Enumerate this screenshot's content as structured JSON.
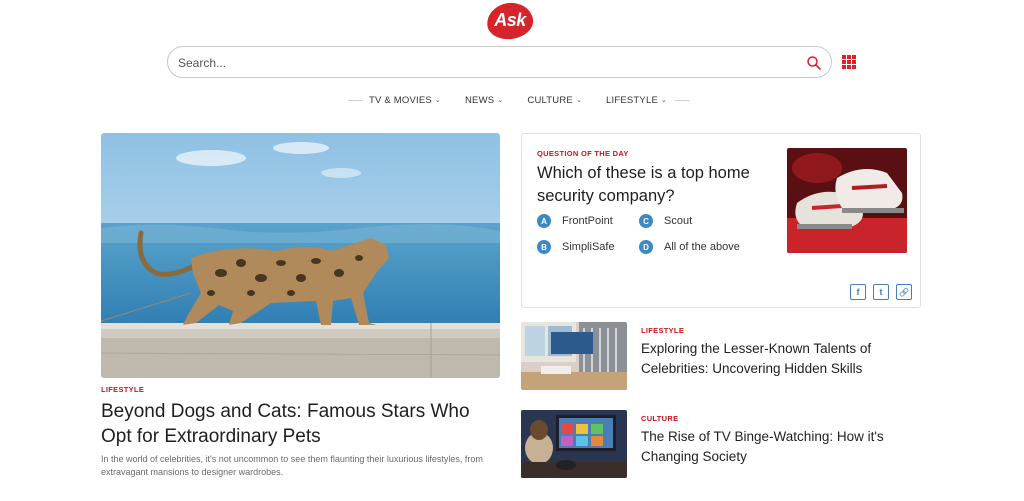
{
  "brand": {
    "logo_text": "Ask",
    "accent": "#d6242a"
  },
  "search": {
    "placeholder": "Search...",
    "icon": "search-icon"
  },
  "apps_icon": "grid-icon",
  "nav": {
    "items": [
      {
        "label": "TV & MOVIES"
      },
      {
        "label": "NEWS"
      },
      {
        "label": "CULTURE"
      },
      {
        "label": "LIFESTYLE"
      }
    ]
  },
  "hero": {
    "category": "LIFESTYLE",
    "title": "Beyond Dogs and Cats: Famous Stars Who Opt for Extraordinary Pets",
    "description": "In the world of celebrities, it's not uncommon to see them flaunting their luxurious lifestyles, from extravagant mansions to designer wardrobes."
  },
  "question": {
    "label": "QUESTION OF THE DAY",
    "text": "Which of these is a top home security company?",
    "options": [
      {
        "letter": "A",
        "label": "FrontPoint"
      },
      {
        "letter": "B",
        "label": "SimpliSafe"
      },
      {
        "letter": "C",
        "label": "Scout"
      },
      {
        "letter": "D",
        "label": "All of the above"
      }
    ],
    "share": {
      "facebook": "f",
      "twitter": "t",
      "link": "🔗"
    }
  },
  "articles": [
    {
      "category": "LIFESTYLE",
      "title": "Exploring the Lesser-Known Talents of Celebrities: Uncovering Hidden Skills"
    },
    {
      "category": "CULTURE",
      "title": "The Rise of TV Binge-Watching: How it's Changing Society"
    }
  ]
}
